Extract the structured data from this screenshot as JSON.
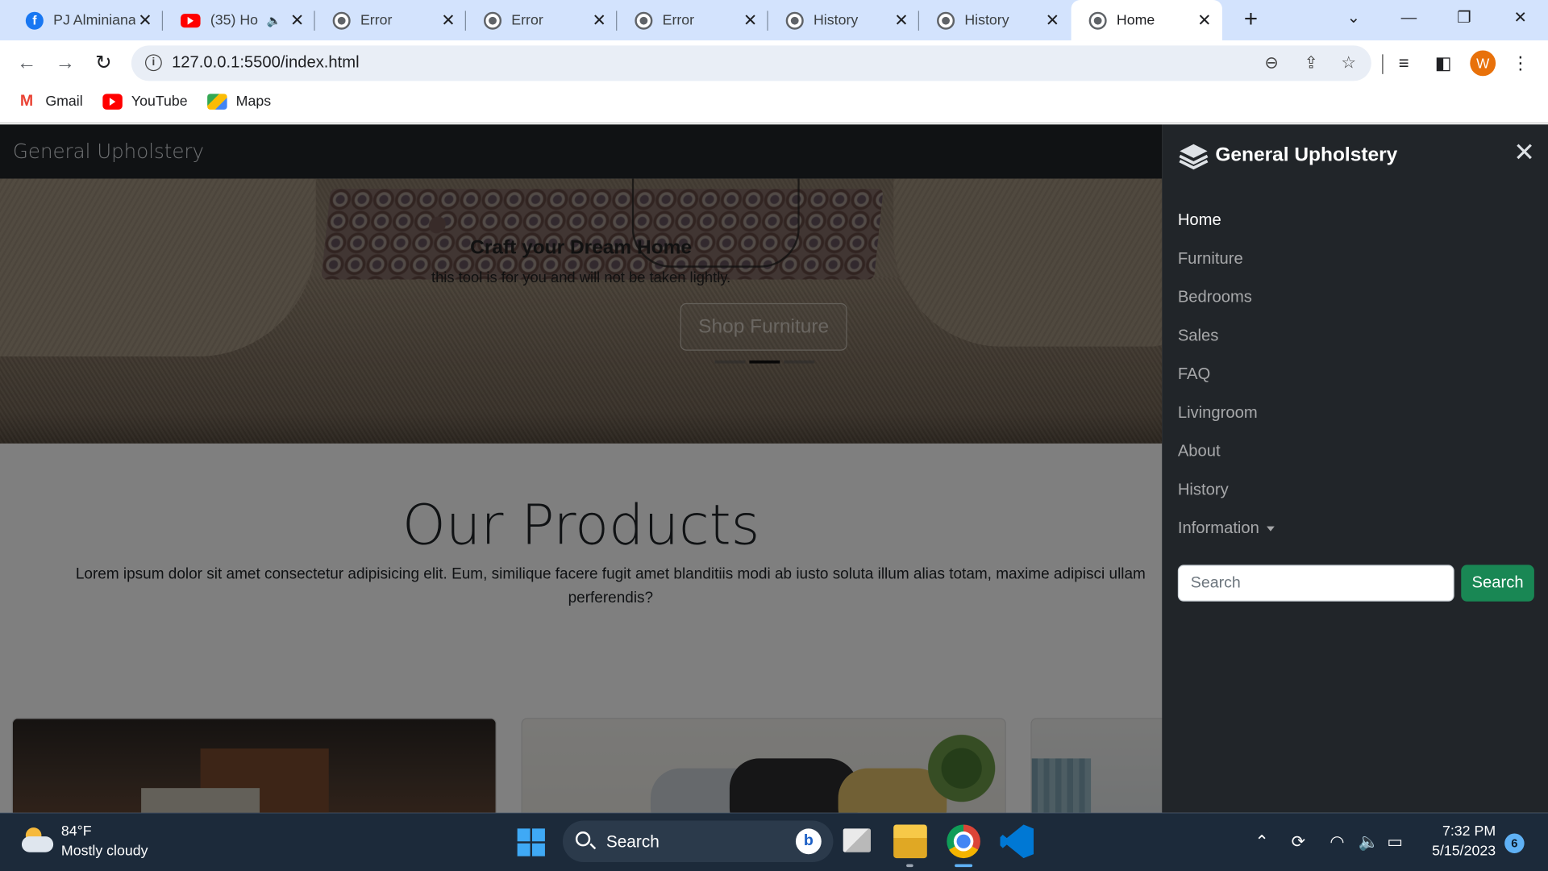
{
  "browser": {
    "tabs": [
      {
        "label": "PJ Alminiana",
        "icon": "facebook-icon"
      },
      {
        "label": "(35) Ho",
        "icon": "youtube-icon",
        "audio": true
      },
      {
        "label": "Error",
        "icon": "globe-icon"
      },
      {
        "label": "Error",
        "icon": "globe-icon"
      },
      {
        "label": "Error",
        "icon": "globe-icon"
      },
      {
        "label": "History",
        "icon": "globe-icon"
      },
      {
        "label": "History",
        "icon": "globe-icon"
      },
      {
        "label": "Home",
        "icon": "globe-icon",
        "active": true
      }
    ],
    "url": "127.0.0.1:5500/index.html",
    "profile_initial": "W",
    "bookmarks": [
      {
        "label": "Gmail",
        "icon": "gmail-icon"
      },
      {
        "label": "YouTube",
        "icon": "youtube-icon"
      },
      {
        "label": "Maps",
        "icon": "maps-icon"
      }
    ]
  },
  "site": {
    "brand": "General Upholstery",
    "hero": {
      "title": "Craft your Dream Home",
      "text": "this tool is for you and will not be taken lightly.",
      "button": "Shop Furniture",
      "active_slide": 2,
      "slide_count": 3
    },
    "products": {
      "title": "Our Products",
      "text": "Lorem ipsum dolor sit amet consectetur adipisicing elit. Eum, similique facere fugit amet blanditiis modi ab iusto soluta illum alias totam, maxime adipisci ullam perferendis?"
    },
    "offcanvas": {
      "title": "General Upholstery",
      "links": [
        "Home",
        "Furniture",
        "Bedrooms",
        "Sales",
        "FAQ",
        "Livingroom",
        "About",
        "History",
        "Information"
      ],
      "active_link": "Home",
      "search_placeholder": "Search",
      "search_button": "Search"
    }
  },
  "taskbar": {
    "temperature": "84°F",
    "weather": "Mostly cloudy",
    "search_label": "Search",
    "time": "7:32 PM",
    "date": "5/15/2023",
    "notifications": "6"
  },
  "colors": {
    "tabstrip": "#d3e3fd",
    "site_dark": "#212529",
    "search_button": "#198754",
    "taskbar": "#1c2a3a",
    "profile": "#e8710a"
  }
}
